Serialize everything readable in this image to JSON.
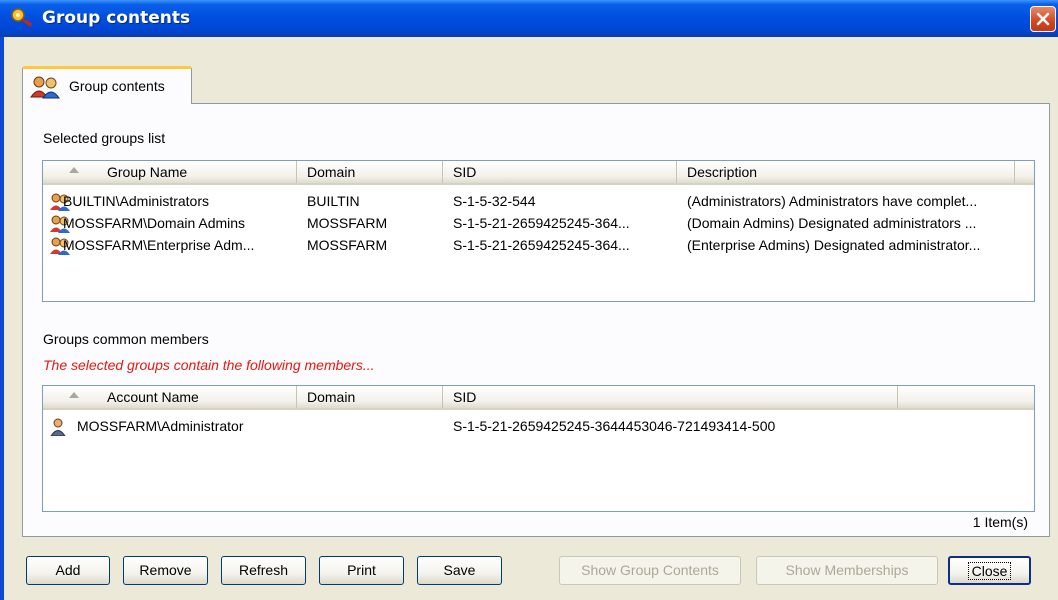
{
  "window": {
    "title": "Group contents"
  },
  "tab": {
    "label": "Group contents"
  },
  "groups_section": {
    "label": "Selected groups list",
    "columns": [
      "Group Name",
      "Domain",
      "SID",
      "Description"
    ],
    "rows": [
      {
        "name": "BUILTIN\\Administrators",
        "domain": "BUILTIN",
        "sid": "S-1-5-32-544",
        "description": "(Administrators) Administrators have complet..."
      },
      {
        "name": "MOSSFARM\\Domain Admins",
        "domain": "MOSSFARM",
        "sid": "S-1-5-21-2659425245-364...",
        "description": "(Domain Admins) Designated administrators ..."
      },
      {
        "name": "MOSSFARM\\Enterprise Adm...",
        "domain": "MOSSFARM",
        "sid": "S-1-5-21-2659425245-364...",
        "description": "(Enterprise Admins) Designated administrator..."
      }
    ]
  },
  "members_section": {
    "label": "Groups common members",
    "hint": "The selected groups contain the following members...",
    "columns": [
      "Account Name",
      "Domain",
      "SID"
    ],
    "rows": [
      {
        "name": "MOSSFARM\\Administrator",
        "domain": "",
        "sid": "S-1-5-21-2659425245-3644453046-721493414-500"
      }
    ]
  },
  "status": {
    "count": "1 Item(s)"
  },
  "buttons": {
    "add": "Add",
    "remove": "Remove",
    "refresh": "Refresh",
    "print": "Print",
    "save": "Save",
    "show_group_contents": "Show Group Contents",
    "show_memberships": "Show Memberships",
    "close": "Close"
  },
  "icons": {
    "app": "key-icon",
    "group": "group-icon",
    "user": "user-icon",
    "close": "close-icon"
  },
  "colors": {
    "hint": "#e8170f",
    "titlebar": "#0050e0",
    "close": "#d44520"
  }
}
